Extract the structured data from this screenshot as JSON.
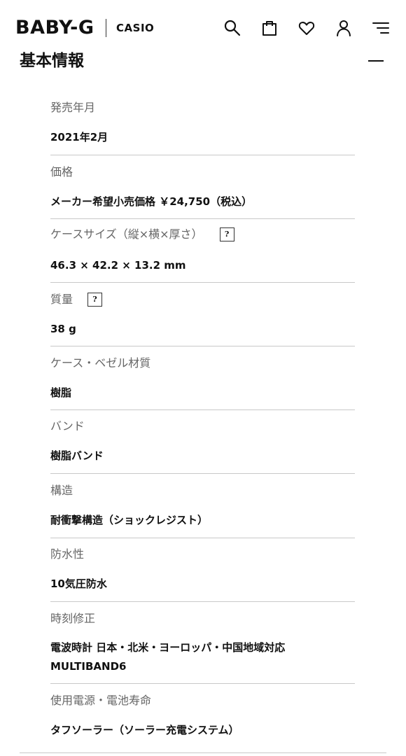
{
  "header": {
    "brand": "BABY-G",
    "maker": "CASIO",
    "icons": [
      "search-icon",
      "shopping-bag-icon",
      "heart-icon",
      "user-icon",
      "menu-icon"
    ]
  },
  "section": {
    "title": "基本情報",
    "expanded": true,
    "help_mark": "?"
  },
  "specs": [
    {
      "label": "発売年月",
      "value": "2021年2月",
      "has_help": false
    },
    {
      "label": "価格",
      "value": "メーカー希望小売価格 ￥24,750（税込）",
      "has_help": false
    },
    {
      "label": "ケースサイズ（縦×横×厚さ）",
      "value": "46.3 × 42.2 × 13.2 mm",
      "has_help": true
    },
    {
      "label": "質量",
      "value": "38 g",
      "has_help": true
    },
    {
      "label": "ケース・ベゼル材質",
      "value": "樹脂",
      "has_help": false
    },
    {
      "label": "バンド",
      "value": "樹脂バンド",
      "has_help": false
    },
    {
      "label": "構造",
      "value": "耐衝撃構造（ショックレジスト）",
      "has_help": false
    },
    {
      "label": "防水性",
      "value": "10気圧防水",
      "has_help": false
    },
    {
      "label": "時刻修正",
      "value_line1": "電波時計 日本・北米・ヨーロッパ・中国地域対応",
      "value_line2": "MULTIBAND6",
      "has_help": false
    },
    {
      "label": "使用電源・電池寿命",
      "value": "タフソーラー（ソーラー充電システム）",
      "has_help": false
    }
  ]
}
